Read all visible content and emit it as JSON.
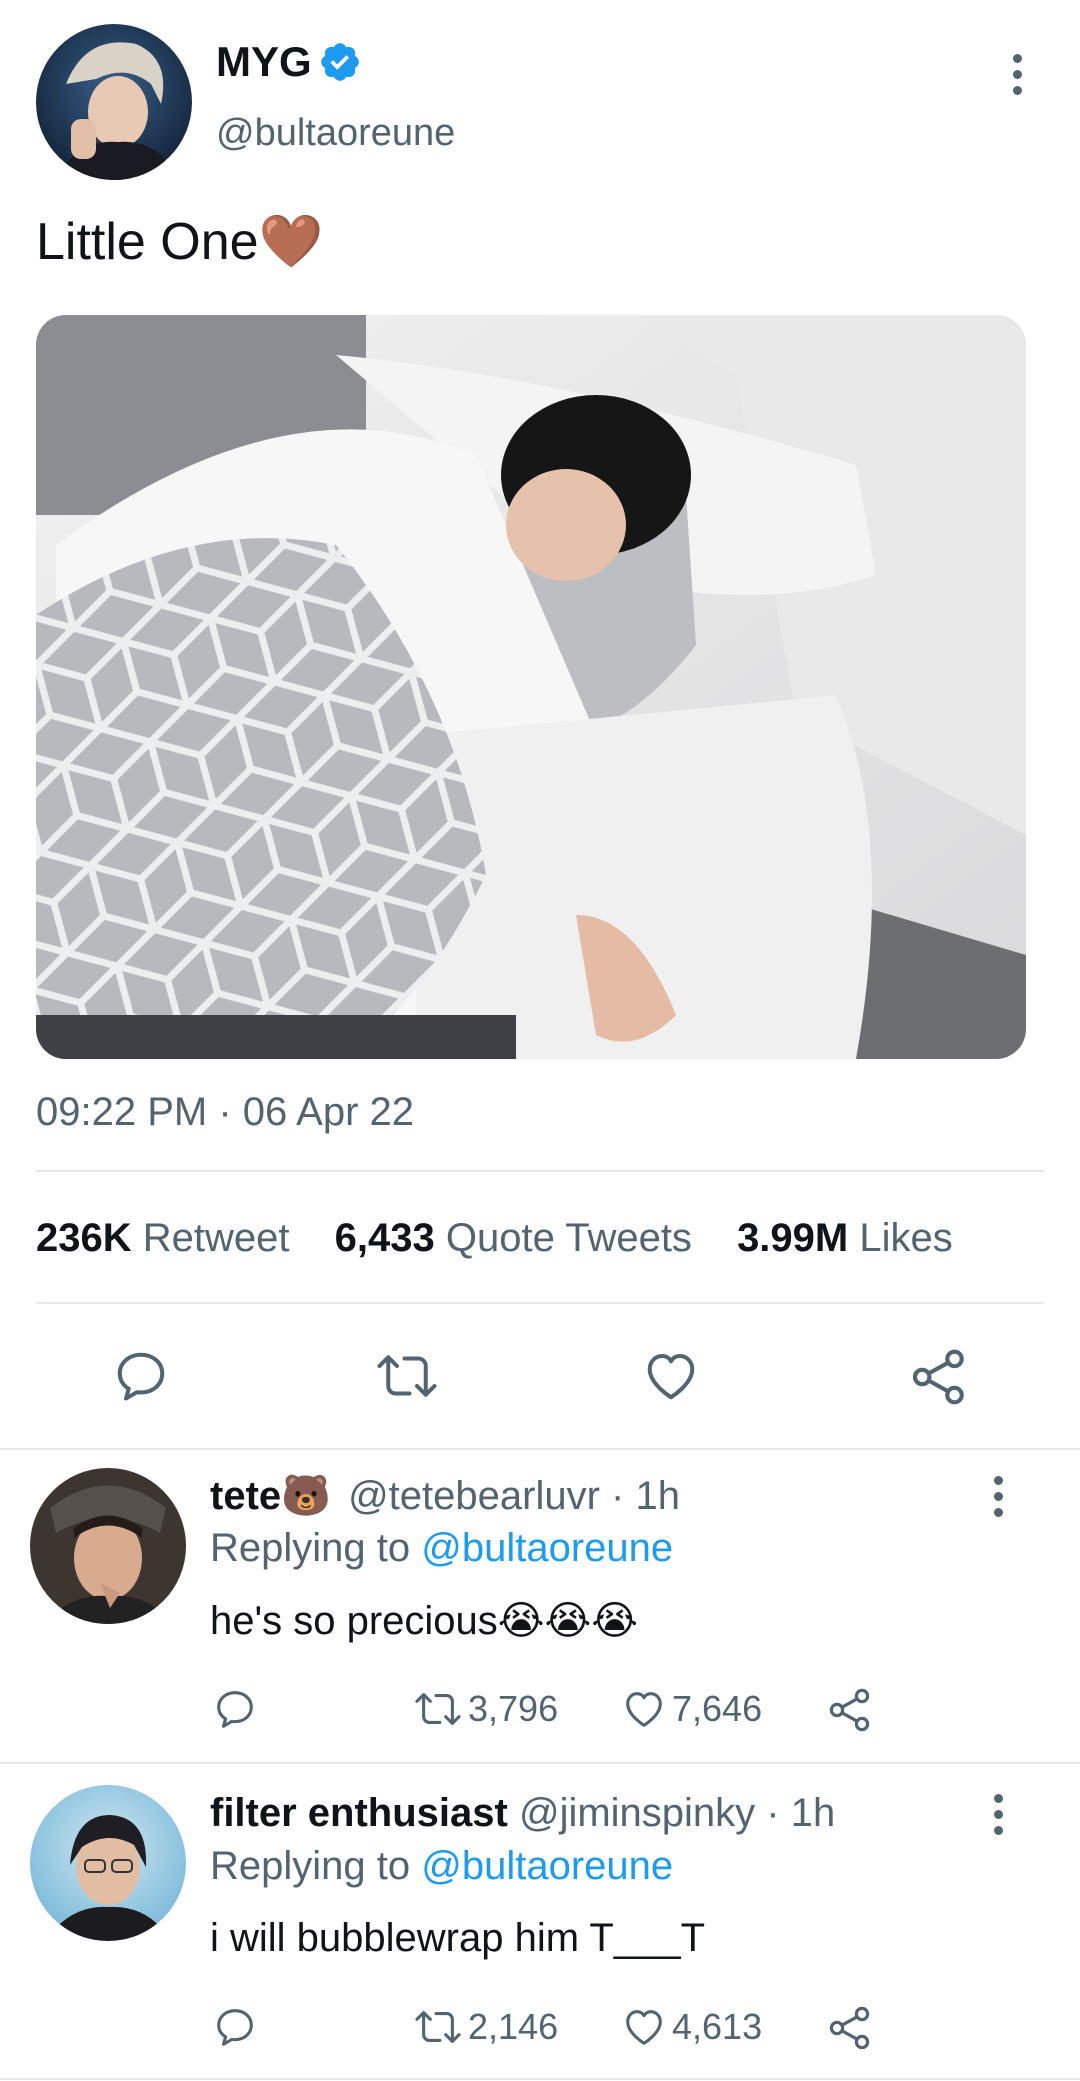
{
  "tweet": {
    "display_name": "MYG",
    "handle": "@bultaoreune",
    "text": "Little One",
    "emoji": "🤎",
    "timestamp": "09:22 PM · 06 Apr 22",
    "stats": {
      "retweets_value": "236K",
      "retweets_label": "Retweet",
      "quotes_value": "6,433",
      "quotes_label": "Quote Tweets",
      "likes_value": "3.99M",
      "likes_label": "Likes"
    },
    "icons": [
      "reply-icon",
      "retweet-icon",
      "like-icon",
      "share-icon"
    ]
  },
  "replies": [
    {
      "name": "tete",
      "name_emoji": "🐻",
      "handle": "@tetebearluvr",
      "time": " · 1h",
      "replying_label": "Replying to",
      "replying_handle": "@bultaoreune",
      "text": "he's so precious",
      "text_emoji": "😭😭😭",
      "retweets": "3,796",
      "likes": "7,646"
    },
    {
      "name": "filter enthusiast",
      "handle": "@jiminspinky",
      "time": " · 1h",
      "replying_label": "Replying to",
      "replying_handle": "@bultaoreune",
      "text": "i will bubblewrap him T___T",
      "retweets": "2,146",
      "likes": "4,613"
    }
  ],
  "colors": {
    "accent": "#1d9bf0",
    "muted": "#536471",
    "divider": "#e6e9ec"
  }
}
